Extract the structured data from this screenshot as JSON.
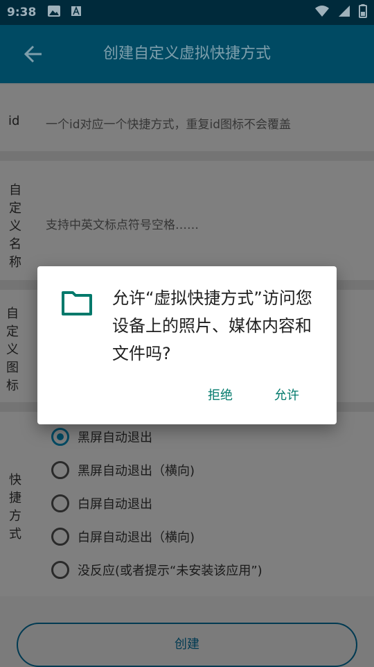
{
  "status_bar": {
    "time": "9:38"
  },
  "app_bar": {
    "title": "创建自定义虚拟快捷方式"
  },
  "form": {
    "id_label": "id",
    "id_hint": "一个id对应一个快捷方式，重复id图标不会覆盖",
    "name_label_chars": [
      "自",
      "定",
      "义",
      "名",
      "称"
    ],
    "name_hint": "支持中英文标点符号空格……",
    "icon_label_chars": [
      "自",
      "定",
      "义",
      "图",
      "标"
    ],
    "shortcut_label_chars": [
      "快",
      "捷",
      "方",
      "式"
    ],
    "options": [
      {
        "label": "黑屏自动退出",
        "selected": true
      },
      {
        "label": "黑屏自动退出（横向)",
        "selected": false
      },
      {
        "label": "白屏自动退出",
        "selected": false
      },
      {
        "label": "白屏自动退出（横向)",
        "selected": false
      },
      {
        "label": "没反应(或者提示“未安装该应用”)",
        "selected": false
      }
    ],
    "create_button": "创建"
  },
  "dialog": {
    "message": "允许“虚拟快捷方式”访问您设备上的照片、媒体内容和文件吗?",
    "deny": "拒绝",
    "allow": "允许"
  },
  "colors": {
    "accent": "#00796b",
    "app_bar": "#004a63",
    "status_bar": "#002a3b"
  }
}
